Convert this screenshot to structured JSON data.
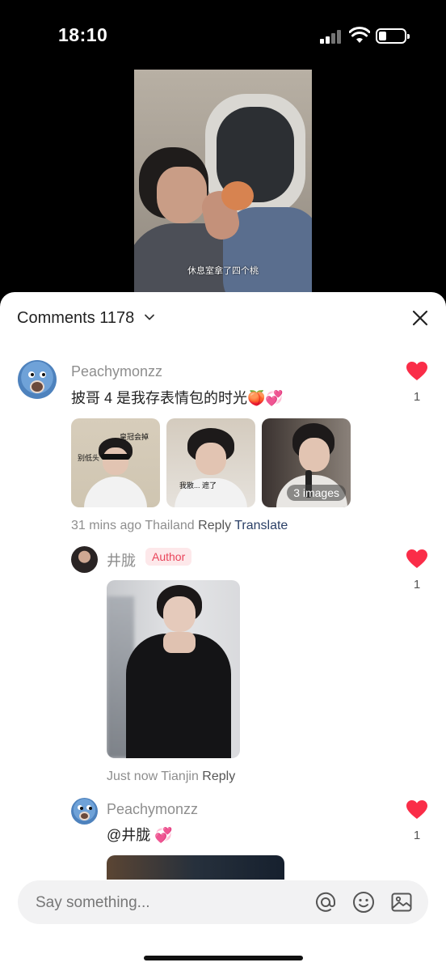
{
  "status_bar": {
    "time": "18:10"
  },
  "video": {
    "subtitle": "休息室拿了四个桃"
  },
  "header": {
    "title": "Comments 1178"
  },
  "comments": [
    {
      "username": "Peachymonzz",
      "text": "披哥 4 是我存表情包的时光🍑💞",
      "likes": "1",
      "images": [
        {
          "caption": "别低头",
          "caption2": "皇冠会掉"
        },
        {
          "caption": "我散... 遮了"
        },
        {
          "caption": ""
        }
      ],
      "more_images": "3 images",
      "time": "31 mins ago",
      "location": "Thailand",
      "reply_label": "Reply",
      "translate_label": "Translate"
    },
    {
      "username": "井胧",
      "badge": "Author",
      "likes": "1",
      "time": "Just now",
      "location": "Tianjin",
      "reply_label": "Reply"
    },
    {
      "username": "Peachymonzz",
      "text": "@井胧 💞",
      "likes": "1"
    }
  ],
  "input": {
    "placeholder": "Say something..."
  },
  "colors": {
    "like_red": "#fa2d48",
    "author_badge_bg": "#fde8ea",
    "author_badge_text": "#e9445a",
    "translate": "#2a3f66"
  },
  "icons": {
    "close": "close-icon",
    "mention": "at-icon",
    "emoji": "emoji-icon",
    "image": "image-icon",
    "like": "heart-icon",
    "dropdown": "chevron-down-icon"
  }
}
